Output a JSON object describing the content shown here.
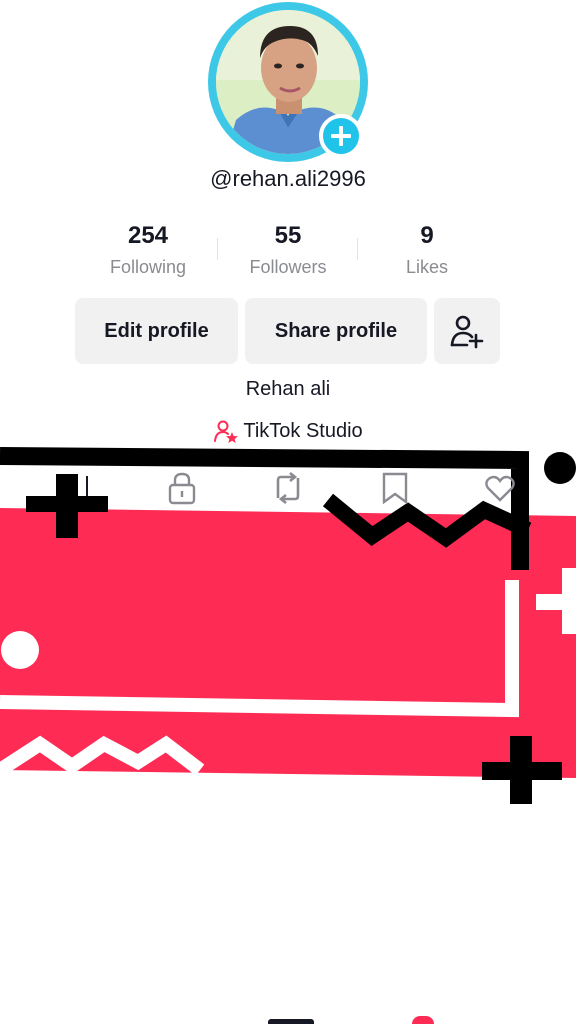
{
  "profile": {
    "username": "@rehan.ali2996",
    "display_name": "Rehan ali",
    "studio_link": "TikTok Studio"
  },
  "stats": [
    {
      "value": "254",
      "label": "Following"
    },
    {
      "value": "55",
      "label": "Followers"
    },
    {
      "value": "9",
      "label": "Likes"
    }
  ],
  "buttons": {
    "edit_profile": "Edit profile",
    "share_profile": "Share profile"
  },
  "icons": {
    "avatar_add": "plus-icon",
    "add_friend": "add-user-icon",
    "studio": "creator-star-icon",
    "tabs": [
      "videos-icon",
      "lock-icon",
      "repost-icon",
      "bookmark-icon",
      "heart-icon"
    ]
  },
  "colors": {
    "accent_cyan": "#3cc8e6",
    "brand_red": "#fe2c55",
    "button_bg": "#f1f1f2"
  }
}
